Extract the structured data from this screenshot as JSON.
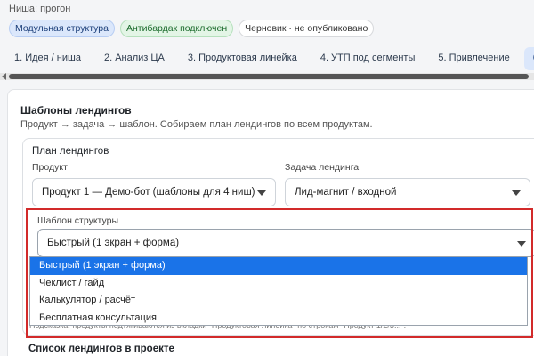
{
  "niche_label": "Ниша: прогон",
  "badges": {
    "structure": "Модульная структура",
    "antibardak": "Антибардак подключен",
    "draft": "Черновик · не опубликовано"
  },
  "tabs": [
    "1. Идея / ниша",
    "2. Анализ ЦА",
    "3. Продуктовая линейка",
    "4. УТП под сегменты",
    "5. Привлечение",
    "6. Шаб"
  ],
  "section": {
    "title": "Шаблоны лендингов",
    "subtitle": "Продукт → задача → шаблон. Собираем план лендингов по всем продуктам."
  },
  "plan": {
    "title": "План лендингов",
    "product_label": "Продукт",
    "product_value": "Продукт 1 — Демо-бот (шаблоны для 4 ниш)",
    "task_label": "Задача лендинга",
    "task_value": "Лид-магнит / входной",
    "structure_label": "Шаблон структуры",
    "structure_value": "Быстрый (1 экран + форма)",
    "options": [
      "Быстрый (1 экран + форма)",
      "Чеклист / гайд",
      "Калькулятор / расчёт",
      "Бесплатная консультация"
    ],
    "hint": "Подсказка: продукты подтягиваются из вкладки \"Продуктовая линейка\" по строкам \"Продукт 1/2/3...\"."
  },
  "list_title": "Список лендингов в проекте",
  "colors": {
    "accent": "#1a73e8",
    "highlight": "#d22a2a"
  }
}
